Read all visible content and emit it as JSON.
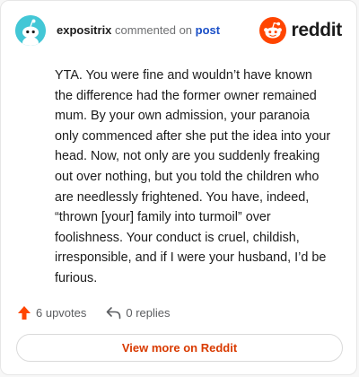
{
  "header": {
    "username": "expositrix",
    "action_text": "commented on",
    "post_link": "post",
    "logo_text": "reddit",
    "avatar_icon": "snoo-avatar-icon",
    "logo_icon": "reddit-snoo-logo-icon"
  },
  "comment": {
    "text": "YTA. You were fine and wouldn’t have known the difference had the former owner remained mum. By your own admission, your paranoia only commenced after she put the idea into your head. Now, not only are you suddenly freaking out over nothing, but you told the children who are needlessly frightened. You have, indeed, “thrown [your] family into turmoil” over foolishness. Your conduct is cruel, childish, irresponsible, and if I were your husband, I’d be furious."
  },
  "footer": {
    "upvotes": "6 upvotes",
    "replies": "0 replies",
    "upvote_icon": "upvote-arrow-icon",
    "reply_icon": "reply-arrow-icon",
    "view_more": "View more on Reddit"
  },
  "colors": {
    "brand": "#ff4500",
    "link": "#1a4fc7",
    "view_more_text": "#d93a00",
    "avatar_bg": "#43c7d6"
  }
}
